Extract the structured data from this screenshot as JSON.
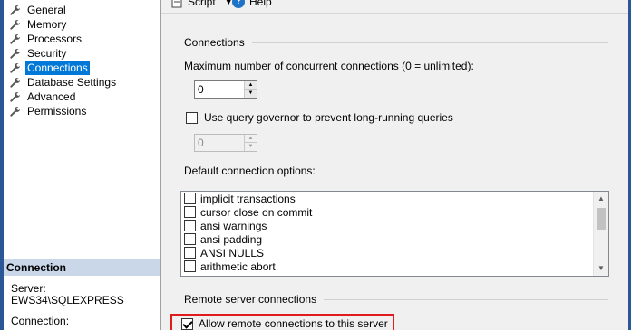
{
  "nav": {
    "items": [
      {
        "label": "General",
        "selected": false
      },
      {
        "label": "Memory",
        "selected": false
      },
      {
        "label": "Processors",
        "selected": false
      },
      {
        "label": "Security",
        "selected": false
      },
      {
        "label": "Connections",
        "selected": true
      },
      {
        "label": "Database Settings",
        "selected": false
      },
      {
        "label": "Advanced",
        "selected": false
      },
      {
        "label": "Permissions",
        "selected": false
      }
    ]
  },
  "connection_panel": {
    "header": "Connection",
    "server_label": "Server:",
    "server_value": "EWS34\\SQLEXPRESS",
    "connection_label": "Connection:"
  },
  "toolbar": {
    "script_label": "Script",
    "help_label": "Help",
    "help_glyph": "?"
  },
  "connections": {
    "section_title": "Connections",
    "max_label": "Maximum number of concurrent connections (0 = unlimited):",
    "max_value": "0",
    "governor_label": "Use query governor to prevent long-running queries",
    "governor_checked": false,
    "governor_value": "0",
    "default_options_label": "Default connection options:",
    "options": [
      {
        "label": "implicit transactions",
        "checked": false
      },
      {
        "label": "cursor close on commit",
        "checked": false
      },
      {
        "label": "ansi warnings",
        "checked": false
      },
      {
        "label": "ansi padding",
        "checked": false
      },
      {
        "label": "ANSI NULLS",
        "checked": false
      },
      {
        "label": "arithmetic abort",
        "checked": false
      }
    ]
  },
  "remote": {
    "section_title": "Remote server connections",
    "allow_label": "Allow remote connections to this server",
    "allow_checked": true
  },
  "colors": {
    "selection": "#0078d7",
    "highlight": "#e01b1b",
    "panel_header": "#c9d7e8"
  }
}
